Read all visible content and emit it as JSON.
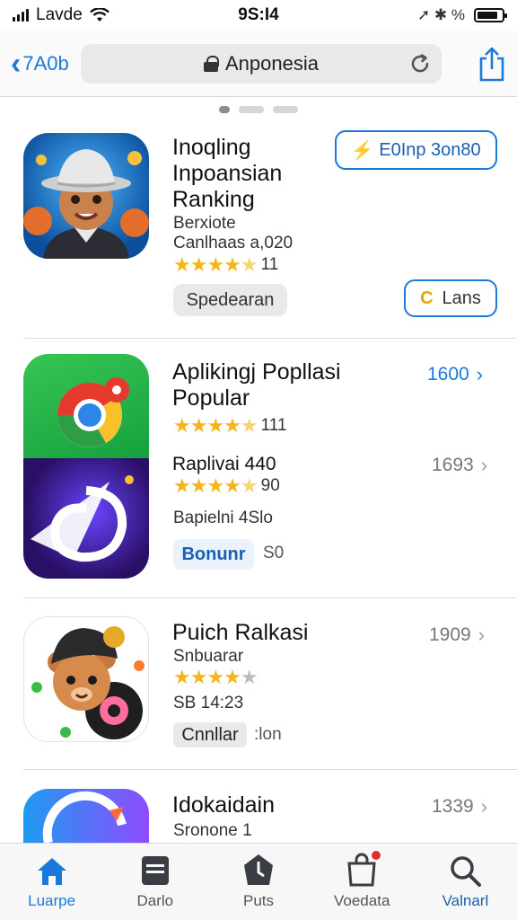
{
  "status_bar": {
    "carrier": "Lavde",
    "time": "9S:I4",
    "right_glyphs": "➚ ✱ %",
    "battery_level": 0.85
  },
  "nav": {
    "back_label": "7A0b",
    "url": "Anponesia",
    "accent_color": "#1a7ad9"
  },
  "carousel": {
    "page_count": 3,
    "active_index": 0
  },
  "apps": [
    {
      "title_lines": [
        "Inoqling",
        "Inpoansian",
        "Ranking"
      ],
      "meta_1": "Berxiote",
      "meta_2": "Canlhaas a,020",
      "rating_stars": 4.5,
      "rating_count": "11",
      "top_button": "E0Inp 3on80",
      "tag": "Spedearan",
      "action_icon_letter": "C",
      "action_button": "Lans"
    },
    {
      "title_lines": [
        "Aplikingj Popllasi",
        "Popular"
      ],
      "rating_stars": 4.5,
      "rating_count": "111",
      "price": "1600",
      "price_color": "#1a7ad9",
      "sub_title": "Raplivai 440",
      "sub_rating_stars": 4.5,
      "sub_rating_count": "90",
      "sub_price": "1693",
      "sub_meta": "Bapielni 4Slo",
      "badge_label": "Bonunr",
      "badge_value": "S0"
    },
    {
      "title": "Puich Ralkasi",
      "meta_1": "Snbuarar",
      "rating_stars": 4,
      "meta_2": "SB 14:23",
      "price": "1909",
      "tag": "Cnnllar",
      "tag_suffix": ":lon"
    },
    {
      "title": "Idokaidain",
      "meta_1": "Sronone 1",
      "price": "1339"
    }
  ],
  "tabs": [
    {
      "label": "Luarpe",
      "icon": "home-icon",
      "active": true
    },
    {
      "label": "Darlo",
      "icon": "tray-icon",
      "active": false
    },
    {
      "label": "Puts",
      "icon": "clock-icon",
      "active": false
    },
    {
      "label": "Voedata",
      "icon": "bag-icon",
      "active": false,
      "badge": true
    },
    {
      "label": "Valnarl",
      "icon": "search-icon",
      "active": false
    }
  ]
}
